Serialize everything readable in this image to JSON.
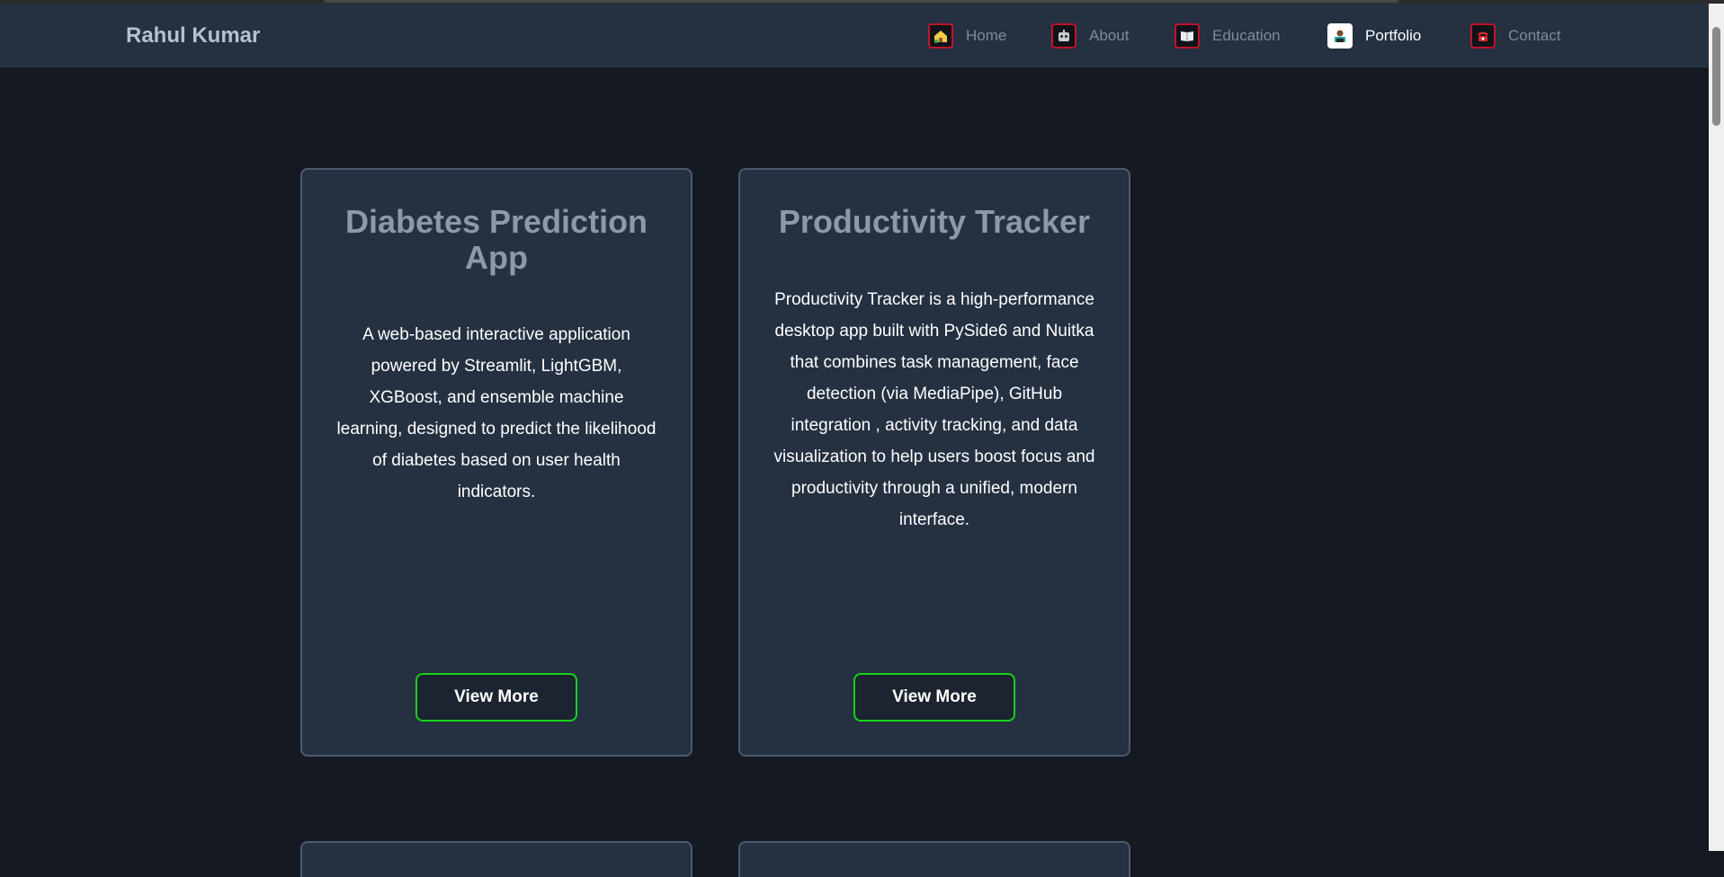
{
  "header": {
    "brand": "Rahul Kumar",
    "nav": [
      {
        "label": "Home",
        "icon": "house-icon",
        "active": false
      },
      {
        "label": "About",
        "icon": "robot-icon",
        "active": false
      },
      {
        "label": "Education",
        "icon": "book-icon",
        "active": false
      },
      {
        "label": "Portfolio",
        "icon": "technologist-icon",
        "active": true
      },
      {
        "label": "Contact",
        "icon": "telephone-icon",
        "active": false
      }
    ]
  },
  "projects": [
    {
      "title": "Diabetes Prediction App",
      "description": "A web-based interactive application powered by Streamlit, LightGBM, XGBoost, and ensemble machine learning, designed to predict the likelihood of diabetes based on user health indicators.",
      "button": "View More"
    },
    {
      "title": "Productivity Tracker",
      "description": "Productivity Tracker is a high-performance desktop app built with PySide6 and Nuitka that combines task management, face detection (via MediaPipe), GitHub integration , activity tracking, and data visualization to help users boost focus and productivity through a unified, modern interface.",
      "button": "View More"
    }
  ],
  "colors": {
    "background": "#141922",
    "navbar": "#253041",
    "card": "#253041",
    "button_border": "#16d11a",
    "icon_border": "#c0142a"
  }
}
